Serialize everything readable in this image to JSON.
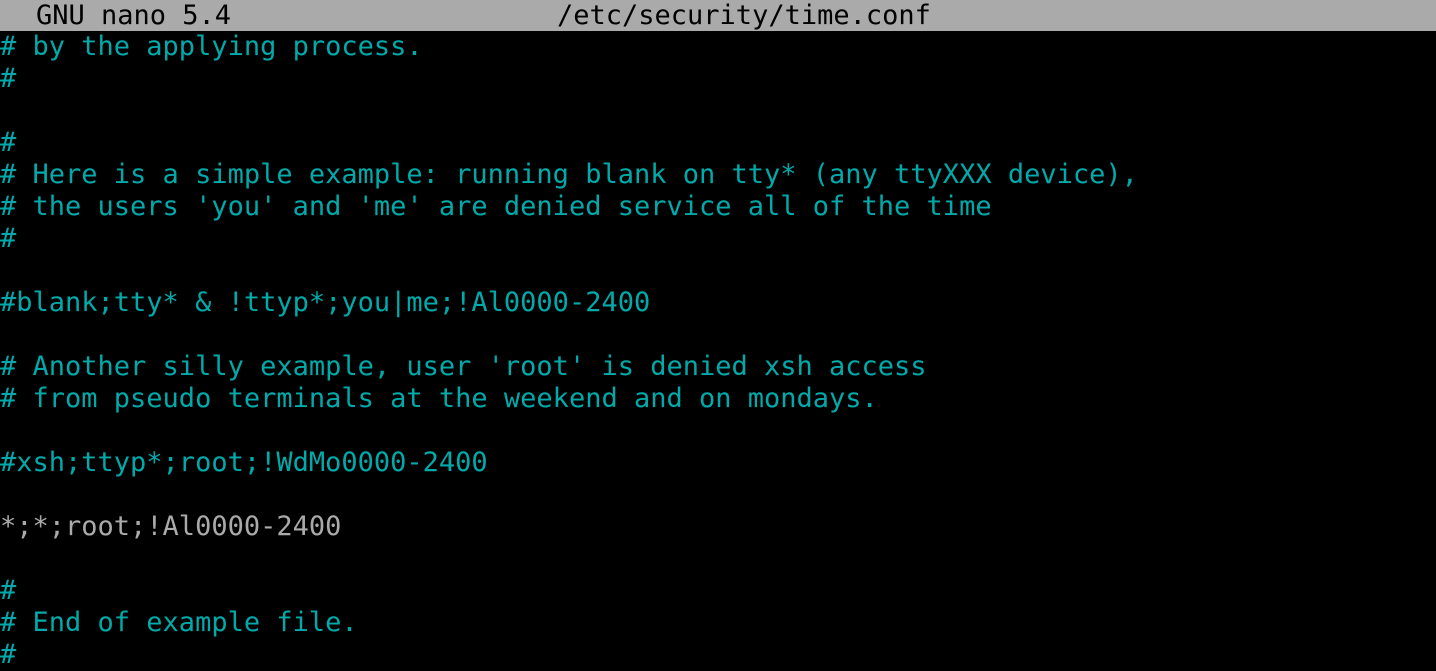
{
  "titlebar": {
    "app_name": "GNU nano 5.4",
    "file_path": "/etc/security/time.conf"
  },
  "colors": {
    "titlebar_bg": "#aaaaaa",
    "background": "#000000",
    "comment": "#00aaaa",
    "plain": "#aaaaaa"
  },
  "editor": {
    "lines": [
      {
        "text": "# by the applying process.",
        "kind": "comment"
      },
      {
        "text": "#",
        "kind": "comment"
      },
      {
        "text": "",
        "kind": "plain"
      },
      {
        "text": "#",
        "kind": "comment"
      },
      {
        "text": "# Here is a simple example: running blank on tty* (any ttyXXX device),",
        "kind": "comment"
      },
      {
        "text": "# the users 'you' and 'me' are denied service all of the time",
        "kind": "comment"
      },
      {
        "text": "#",
        "kind": "comment"
      },
      {
        "text": "",
        "kind": "plain"
      },
      {
        "text": "#blank;tty* & !ttyp*;you|me;!Al0000-2400",
        "kind": "comment"
      },
      {
        "text": "",
        "kind": "plain"
      },
      {
        "text": "# Another silly example, user 'root' is denied xsh access",
        "kind": "comment"
      },
      {
        "text": "# from pseudo terminals at the weekend and on mondays.",
        "kind": "comment"
      },
      {
        "text": "",
        "kind": "plain"
      },
      {
        "text": "#xsh;ttyp*;root;!WdMo0000-2400",
        "kind": "comment"
      },
      {
        "text": "",
        "kind": "plain"
      },
      {
        "text": "*;*;root;!Al0000-2400",
        "kind": "plain"
      },
      {
        "text": "",
        "kind": "plain"
      },
      {
        "text": "#",
        "kind": "comment"
      },
      {
        "text": "# End of example file.",
        "kind": "comment"
      },
      {
        "text": "#",
        "kind": "comment"
      }
    ]
  }
}
